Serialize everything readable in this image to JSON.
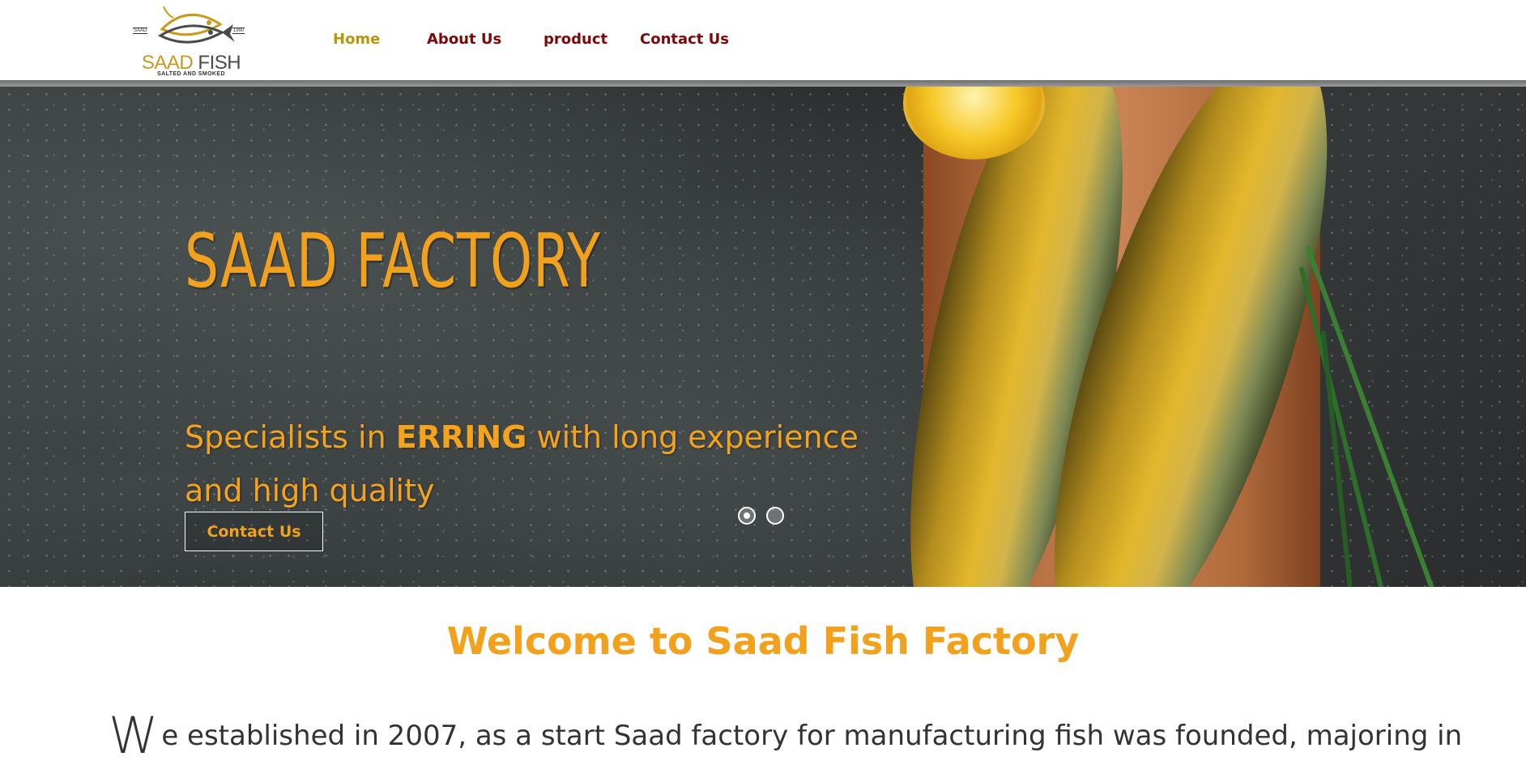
{
  "logo": {
    "brand_first": "SAAD",
    "brand_second": "FISH",
    "tagline": "SALTED AND SMOKED",
    "tag_left": "SAAD",
    "tag_right": "1990"
  },
  "nav": {
    "items": [
      {
        "label": "Home",
        "active": true
      },
      {
        "label": "About Us",
        "active": false
      },
      {
        "label": "product",
        "active": false
      },
      {
        "label": "Contact Us",
        "active": false
      }
    ]
  },
  "hero": {
    "title": "SAAD FACTORY",
    "subtitle_before": "Specialists in ",
    "subtitle_bold": "ERRING",
    "subtitle_after": " with long experience and high quality",
    "button_label": "Contact Us",
    "slides_total": 2,
    "slide_active": 1
  },
  "welcome": {
    "heading": "Welcome to Saad Fish Factory",
    "dropcap": "W",
    "intro_text": "e established in 2007, as a start Saad factory for manufacturing fish was founded, majoring in"
  },
  "colors": {
    "accent_orange": "#f2a11c",
    "nav_dark_red": "#7a0a0a",
    "nav_active_gold": "#b8960f"
  }
}
